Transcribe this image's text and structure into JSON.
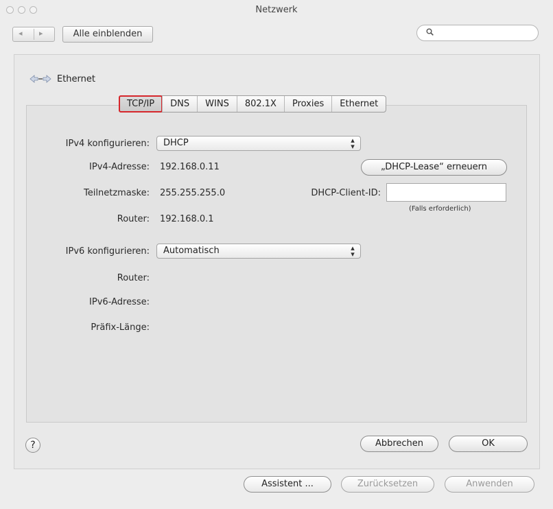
{
  "window": {
    "title": "Netzwerk"
  },
  "toolbar": {
    "back": "◂",
    "forward": "▸",
    "show_all": "Alle einblenden",
    "search_placeholder": ""
  },
  "service": {
    "name": "Ethernet"
  },
  "tabs": [
    "TCP/IP",
    "DNS",
    "WINS",
    "802.1X",
    "Proxies",
    "Ethernet"
  ],
  "active_tab": "TCP/IP",
  "tcpip": {
    "ipv4_config_label": "IPv4 konfigurieren:",
    "ipv4_config_value": "DHCP",
    "ipv4_address_label": "IPv4-Adresse:",
    "ipv4_address_value": "192.168.0.11",
    "renew_lease_button": "„DHCP-Lease“ erneuern",
    "subnet_label": "Teilnetzmaske:",
    "subnet_value": "255.255.255.0",
    "client_id_label": "DHCP-Client-ID:",
    "client_id_value": "",
    "client_id_note": "(Falls erforderlich)",
    "router_label": "Router:",
    "router_value": "192.168.0.1",
    "ipv6_config_label": "IPv6 konfigurieren:",
    "ipv6_config_value": "Automatisch",
    "ipv6_router_label": "Router:",
    "ipv6_address_label": "IPv6-Adresse:",
    "prefix_label": "Präfix-Länge:"
  },
  "dialog": {
    "help": "?",
    "cancel": "Abbrechen",
    "ok": "OK"
  },
  "footer": {
    "assistant": "Assistent ...",
    "revert": "Zurücksetzen",
    "apply": "Anwenden"
  },
  "colors": {
    "highlight": "#d6262b",
    "window_bg": "#ededed"
  }
}
